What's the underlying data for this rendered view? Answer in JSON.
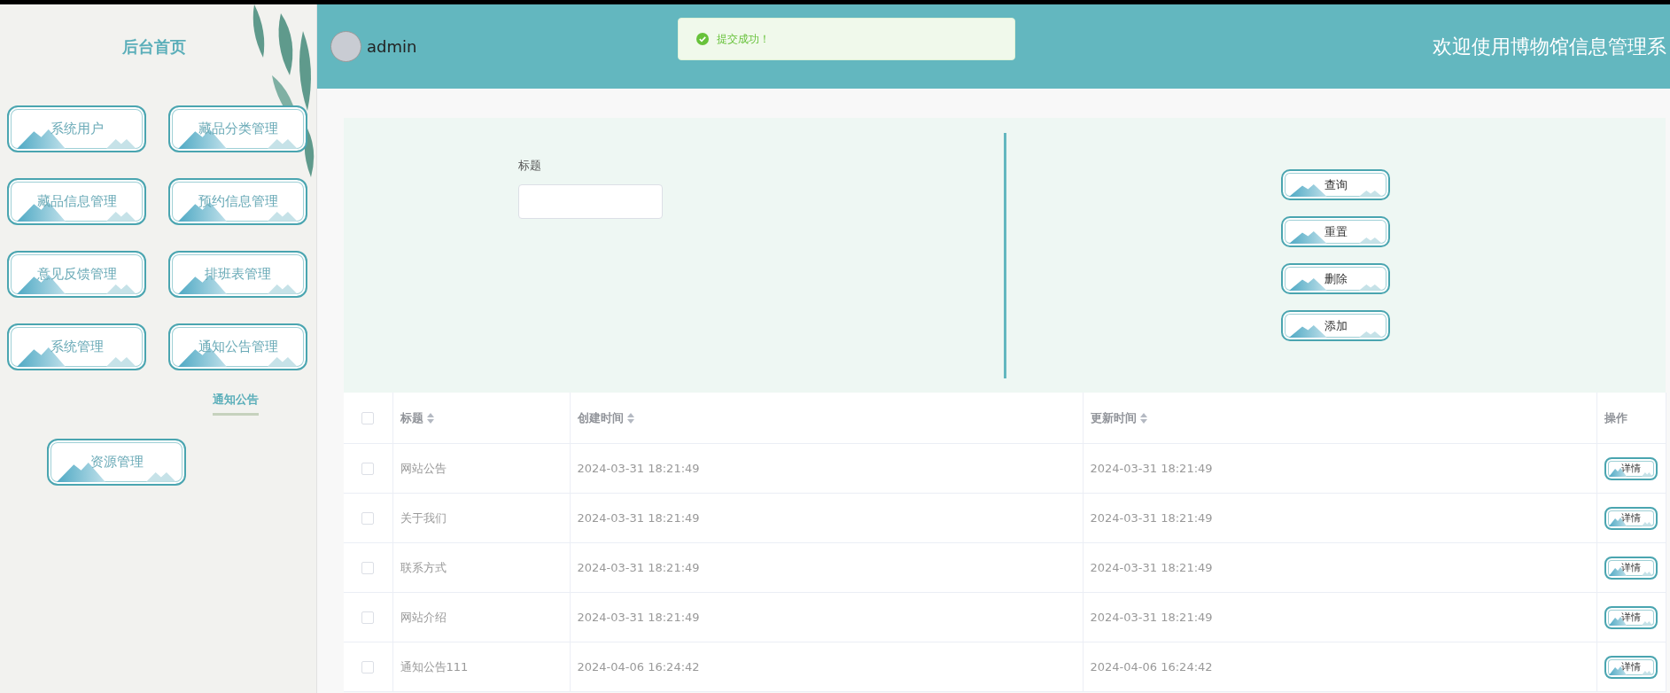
{
  "sidebar": {
    "title": "后台首页",
    "menu": [
      {
        "label": "系统用户"
      },
      {
        "label": "藏品分类管理"
      },
      {
        "label": "藏品信息管理"
      },
      {
        "label": "预约信息管理"
      },
      {
        "label": "意见反馈管理"
      },
      {
        "label": "排班表管理"
      },
      {
        "label": "系统管理"
      },
      {
        "label": "通知公告管理"
      }
    ],
    "notice_link": "通知公告",
    "extra_menu": [
      {
        "label": "资源管理"
      }
    ]
  },
  "header": {
    "username": "admin",
    "welcome": "欢迎使用博物馆信息管理系"
  },
  "toast": {
    "kind": "success",
    "message": "提交成功！"
  },
  "search": {
    "fields": [
      {
        "label": "标题"
      }
    ]
  },
  "actions": [
    "查询",
    "重置",
    "删除",
    "添加"
  ],
  "table": {
    "all_checked": false,
    "columns": [
      {
        "label": "标题",
        "sortable": true
      },
      {
        "label": "创建时间",
        "sortable": true
      },
      {
        "label": "更新时间",
        "sortable": true
      },
      {
        "label": "操作",
        "sortable": false
      }
    ],
    "rows": [
      {
        "checked": false,
        "cells": [
          "网站公告",
          "2024-03-31 18:21:49",
          "2024-03-31 18:21:49"
        ],
        "action": "详情"
      },
      {
        "checked": false,
        "cells": [
          "关于我们",
          "2024-03-31 18:21:49",
          "2024-03-31 18:21:49"
        ],
        "action": "详情"
      },
      {
        "checked": false,
        "cells": [
          "联系方式",
          "2024-03-31 18:21:49",
          "2024-03-31 18:21:49"
        ],
        "action": "详情"
      },
      {
        "checked": false,
        "cells": [
          "网站介绍",
          "2024-03-31 18:21:49",
          "2024-03-31 18:21:49"
        ],
        "action": "详情"
      },
      {
        "checked": false,
        "cells": [
          "通知公告111",
          "2024-04-06 16:24:42",
          "2024-04-06 16:24:42"
        ],
        "action": "详情"
      }
    ]
  }
}
